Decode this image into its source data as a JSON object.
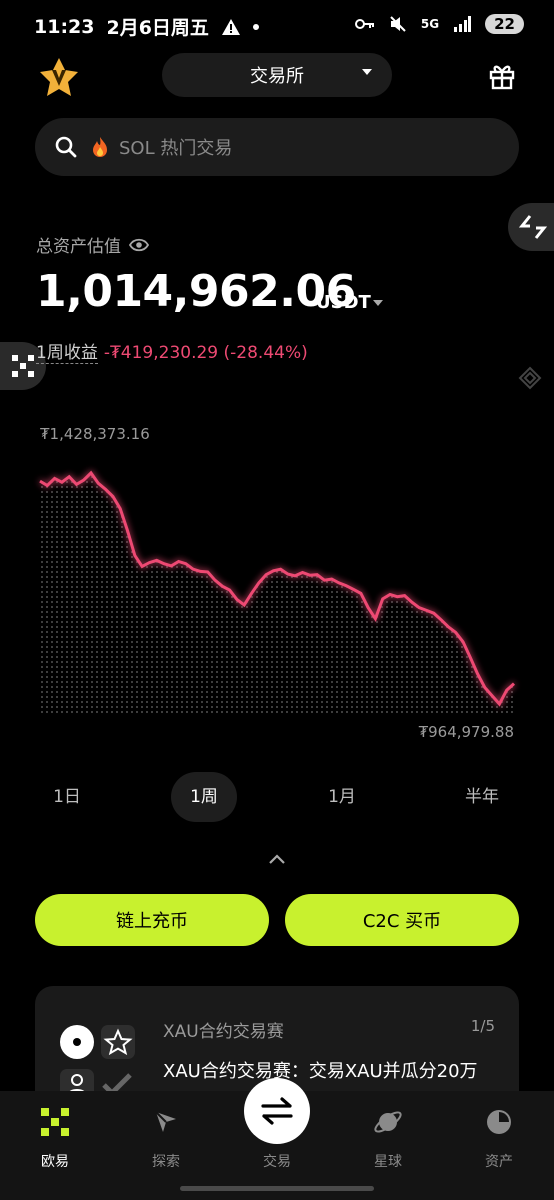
{
  "status_bar": {
    "time": "11:23",
    "date": "2月6日周五",
    "network": "5G",
    "battery": "22"
  },
  "header": {
    "exchange_label": "交易所"
  },
  "search": {
    "placeholder": "SOL 热门交易"
  },
  "assets": {
    "total_label": "总资产估值",
    "total_value": "1,014,962.06",
    "unit": "USDT",
    "pnl_label": "1周收益",
    "pnl_value": "-₮419,230.29 (-28.44%)"
  },
  "chart_data": {
    "type": "line",
    "max_label": "₮1,428,373.16",
    "min_label": "₮964,979.88",
    "ylim": [
      964979.88,
      1428373.16
    ],
    "line_color": "#ee4a73",
    "y": [
      1390000,
      1382000,
      1395000,
      1388000,
      1398000,
      1384000,
      1392000,
      1405000,
      1386000,
      1375000,
      1362000,
      1340000,
      1300000,
      1255000,
      1235000,
      1242000,
      1246000,
      1240000,
      1236000,
      1244000,
      1240000,
      1230000,
      1226000,
      1225000,
      1210000,
      1199000,
      1192000,
      1175000,
      1165000,
      1186000,
      1205000,
      1220000,
      1227000,
      1230000,
      1221000,
      1218000,
      1224000,
      1219000,
      1220000,
      1210000,
      1212000,
      1205000,
      1200000,
      1193000,
      1186000,
      1160000,
      1140000,
      1176000,
      1184000,
      1180000,
      1182000,
      1170000,
      1160000,
      1155000,
      1150000,
      1138000,
      1125000,
      1115000,
      1098000,
      1070000,
      1040000,
      1015000,
      1000000,
      985000,
      1010000,
      1022000
    ]
  },
  "periods": [
    "1日",
    "1周",
    "1月",
    "半年"
  ],
  "active_period": 1,
  "actions": {
    "deposit": "链上充币",
    "buy": "C2C 买币"
  },
  "promo": {
    "title": "XAU合约交易赛",
    "page": "1/5",
    "text": "XAU合约交易赛：交易XAU并瓜分20万"
  },
  "tabbar": {
    "items": [
      {
        "label": "欧易",
        "icon": "okx-logo-icon"
      },
      {
        "label": "探索",
        "icon": "compass-icon"
      },
      {
        "label": "交易",
        "icon": "swap-icon"
      },
      {
        "label": "星球",
        "icon": "planet-icon"
      },
      {
        "label": "资产",
        "icon": "pie-chart-icon"
      }
    ],
    "active_index": 0
  },
  "colors": {
    "accent": "#c8f12e",
    "loss": "#ee4a73",
    "background": "#000000"
  }
}
